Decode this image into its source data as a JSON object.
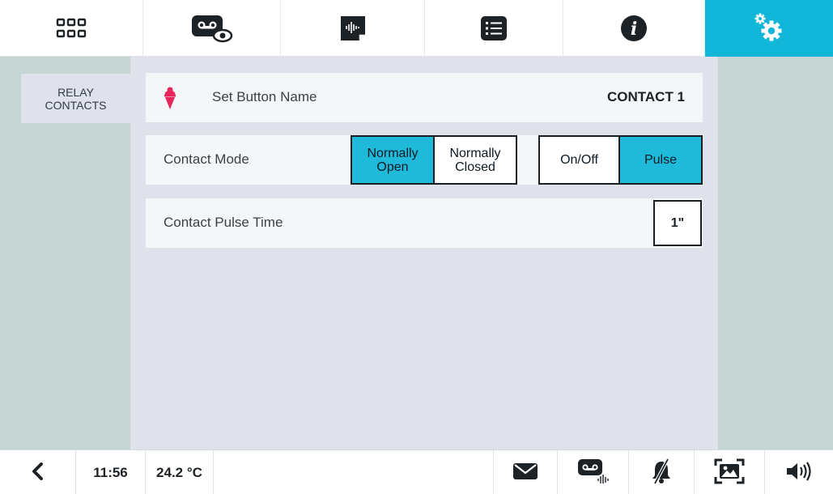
{
  "topbar": {
    "tabs": [
      {
        "icon": "apps-grid-icon",
        "active": false
      },
      {
        "icon": "video-message-view-icon",
        "active": false
      },
      {
        "icon": "audio-file-icon",
        "active": false
      },
      {
        "icon": "list-icon",
        "active": false
      },
      {
        "icon": "info-icon",
        "active": false
      },
      {
        "icon": "settings-gear-icon",
        "active": true
      }
    ],
    "active_color": "#12b6d8"
  },
  "sidebar": {
    "items": [
      {
        "label": "RELAY\nCONTACTS"
      }
    ]
  },
  "main": {
    "button_name": {
      "icon": "ice-cream-icon",
      "label": "Set Button Name",
      "value": "CONTACT 1"
    },
    "contact_mode": {
      "label": "Contact Mode",
      "open_label": "Normally\nOpen",
      "closed_label": "Normally\nClosed",
      "selected": "open",
      "onoff_label": "On/Off",
      "pulse_label": "Pulse",
      "selected_action": "pulse"
    },
    "pulse_time": {
      "label": "Contact Pulse Time",
      "value": "1\""
    }
  },
  "bottombar": {
    "time": "11:56",
    "temperature": "24.2 °C",
    "icons": [
      "back-arrow-icon",
      "mail-icon",
      "voice-message-icon",
      "bell-muted-icon",
      "picture-frame-icon",
      "speaker-icon"
    ]
  },
  "colors": {
    "accent": "#12b6d8",
    "sidebar": "#c5d5d4",
    "content_bg": "#dfe2ea",
    "icecream": "#e8265e"
  }
}
